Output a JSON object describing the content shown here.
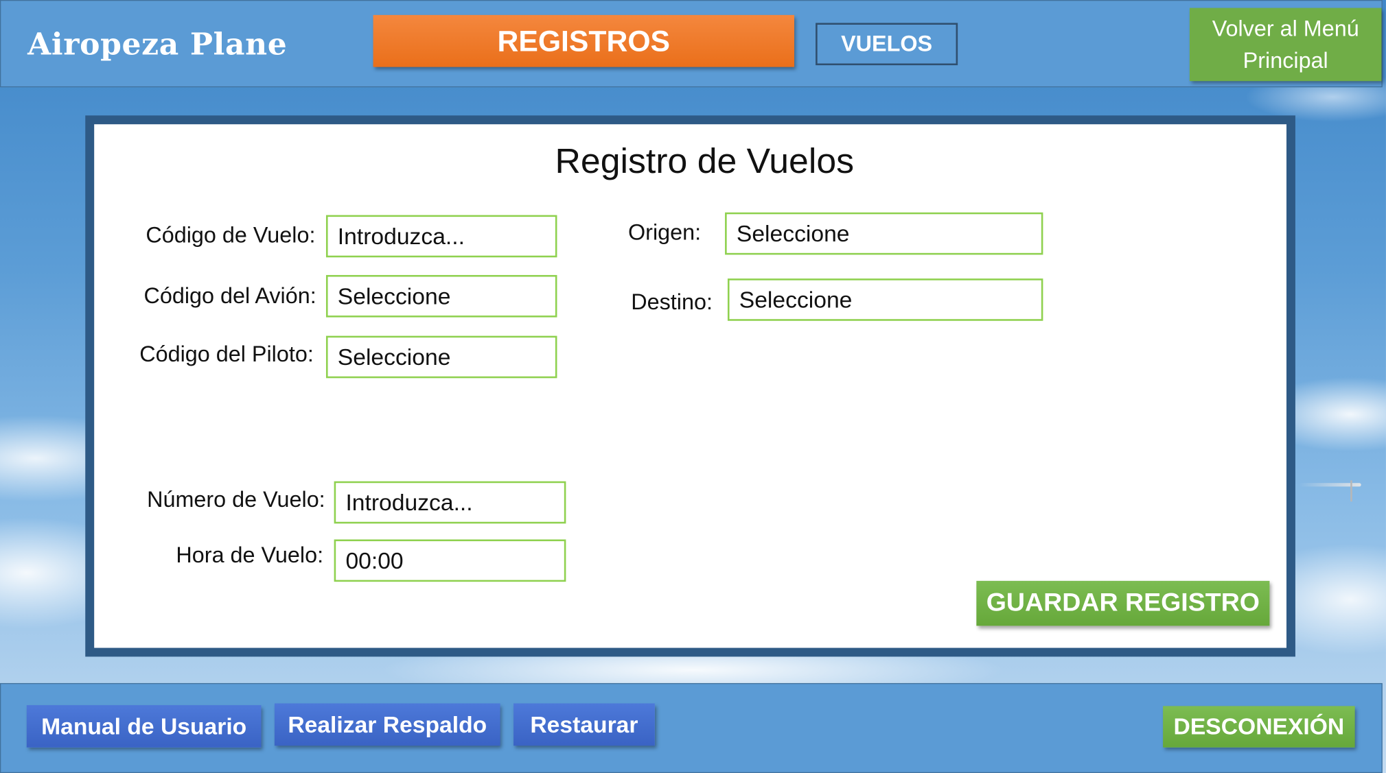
{
  "header": {
    "brand": "Airopeza Plane",
    "section_button": "REGISTROS",
    "subsection_button": "VUELOS",
    "back_button_line1": "Volver al Menú",
    "back_button_line2": "Principal"
  },
  "form": {
    "title": "Registro de Vuelos",
    "codigo_vuelo": {
      "label": "Código de Vuelo:",
      "value": "Introduzca..."
    },
    "codigo_avion": {
      "label": "Código del Avión:",
      "value": "Seleccione"
    },
    "codigo_piloto": {
      "label": "Código del Piloto:",
      "value": "Seleccione"
    },
    "origen": {
      "label": "Origen:",
      "value": "Seleccione"
    },
    "destino": {
      "label": "Destino:",
      "value": "Seleccione"
    },
    "numero_vuelo": {
      "label": "Número de Vuelo:",
      "value": "Introduzca..."
    },
    "hora_vuelo": {
      "label": "Hora de Vuelo:",
      "value": "00:00"
    },
    "save_button": "GUARDAR REGISTRO"
  },
  "footer": {
    "manual_button": "Manual de Usuario",
    "backup_button": "Realizar Respaldo",
    "restore_button": "Restaurar",
    "logout_button": "DESCONEXIÓN"
  },
  "colors": {
    "header_blue": "#5b9bd5",
    "orange_accent": "#ed7d31",
    "green_accent": "#70ad47",
    "field_border": "#8fd14f",
    "panel_border": "#2e5a86",
    "footer_button_blue": "#4472c4"
  }
}
